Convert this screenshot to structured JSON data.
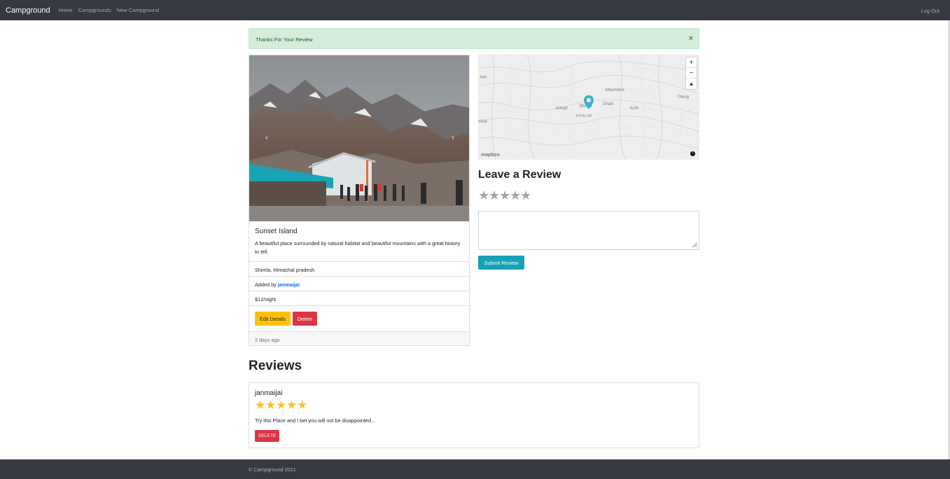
{
  "navbar": {
    "brand": "Campground",
    "links": [
      "Home",
      "Campgrounds",
      "New Campground"
    ],
    "logout": "Log Out"
  },
  "alert": {
    "message": "Thanks For Your Review",
    "close": "×"
  },
  "campground": {
    "carousel_prev": "‹",
    "carousel_next": "›",
    "title": "Sunset Island",
    "description": "A beautiful place surrounded by natural habitat and beautiful mountains with a great history to tell.",
    "location": "Shimla, Himachal pradesh",
    "added_by_prefix": "Added by ",
    "author": "janmaijai",
    "price": "$12/night",
    "edit_label": "Edit Details",
    "delete_label": "Delete",
    "posted": "2 days ago"
  },
  "map": {
    "zoom_in": "+",
    "zoom_out": "−",
    "compass": "▲",
    "labels": {
      "arki": "Arki",
      "mashobra": "Mashobra",
      "theog": "Theog",
      "jutogh": "Jutogh",
      "shimla": "Shimla",
      "dhalli": "Dhalli",
      "kufri": "Kufri",
      "khalini": "KHALINI",
      "sihar": "nihar"
    },
    "logo": "mapbox",
    "info": "i",
    "pin_color": "#3bb2d0"
  },
  "review_form": {
    "heading": "Leave a Review",
    "stars": [
      "★",
      "★",
      "★",
      "★",
      "★"
    ],
    "textarea_value": "",
    "submit_label": "Submit Review"
  },
  "reviews": {
    "heading": "Reviews",
    "items": [
      {
        "author": "janmaijai",
        "rating": 5,
        "stars": [
          "★",
          "★",
          "★",
          "★",
          "★"
        ],
        "text": "Try this Place and I bet you will not be disappointed...",
        "delete_label": "DELETE"
      }
    ]
  },
  "footer": {
    "text": "© Campground 2021"
  },
  "colors": {
    "navbar": "#343a40",
    "alert_bg": "#d4edda",
    "warning": "#ffc107",
    "danger": "#dc3545",
    "info": "#17a2b8",
    "star_filled": "#f0c330",
    "star_empty": "#a6a6a6",
    "link": "#0d6efd"
  }
}
